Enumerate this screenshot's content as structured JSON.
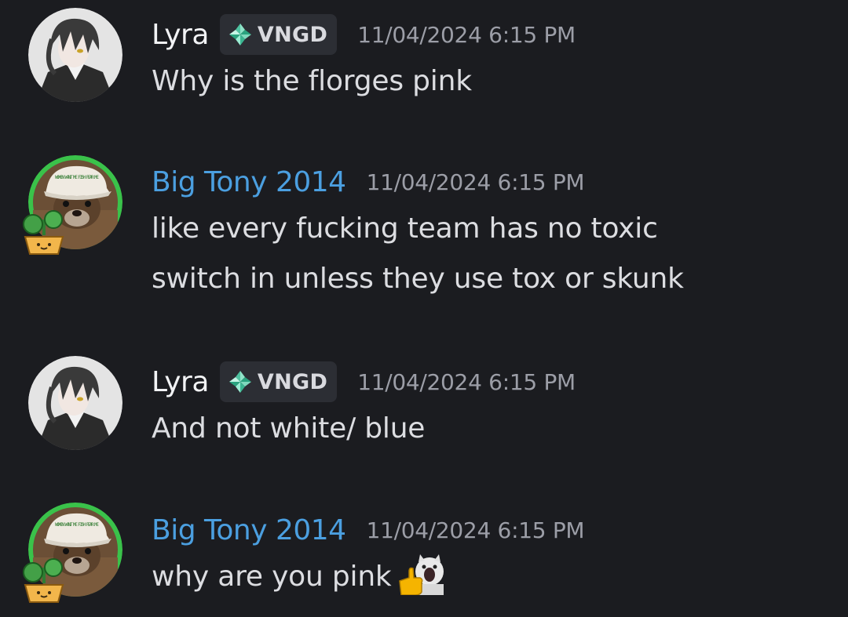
{
  "messages": [
    {
      "author": "Lyra",
      "tag": "VNGD",
      "timestamp": "11/04/2024 6:15 PM",
      "lines": [
        "Why is the florges pink"
      ]
    },
    {
      "author": "Big Tony 2014",
      "timestamp": "11/04/2024 6:15 PM",
      "lines": [
        "like every fucking team has no toxic",
        "switch in unless they use tox or skunk"
      ],
      "avatar_hat_text": "WOMEN WANT ME FISH FEAR ME"
    },
    {
      "author": "Lyra",
      "tag": "VNGD",
      "timestamp": "11/04/2024 6:15 PM",
      "lines": [
        "And not white/ blue"
      ]
    },
    {
      "author": "Big Tony 2014",
      "timestamp": "11/04/2024 6:15 PM",
      "lines": [
        "why are you pink"
      ],
      "avatar_hat_text": "WOMEN WANT ME FISH FEAR ME",
      "emoji": "screaming-cat-thumbs-up-emoji"
    }
  ],
  "colors": {
    "background": "#1b1c20",
    "username_lyra": "#f2f3f5",
    "username_tony": "#4b9fe0",
    "timestamp": "#9c9ea7",
    "tag_bg": "#2c2e34",
    "avatar_ring": "#3ac24a"
  },
  "icons": {
    "tag_icon": "diamond-gem-icon",
    "avatar_decoration": "potted-plant-icon"
  }
}
